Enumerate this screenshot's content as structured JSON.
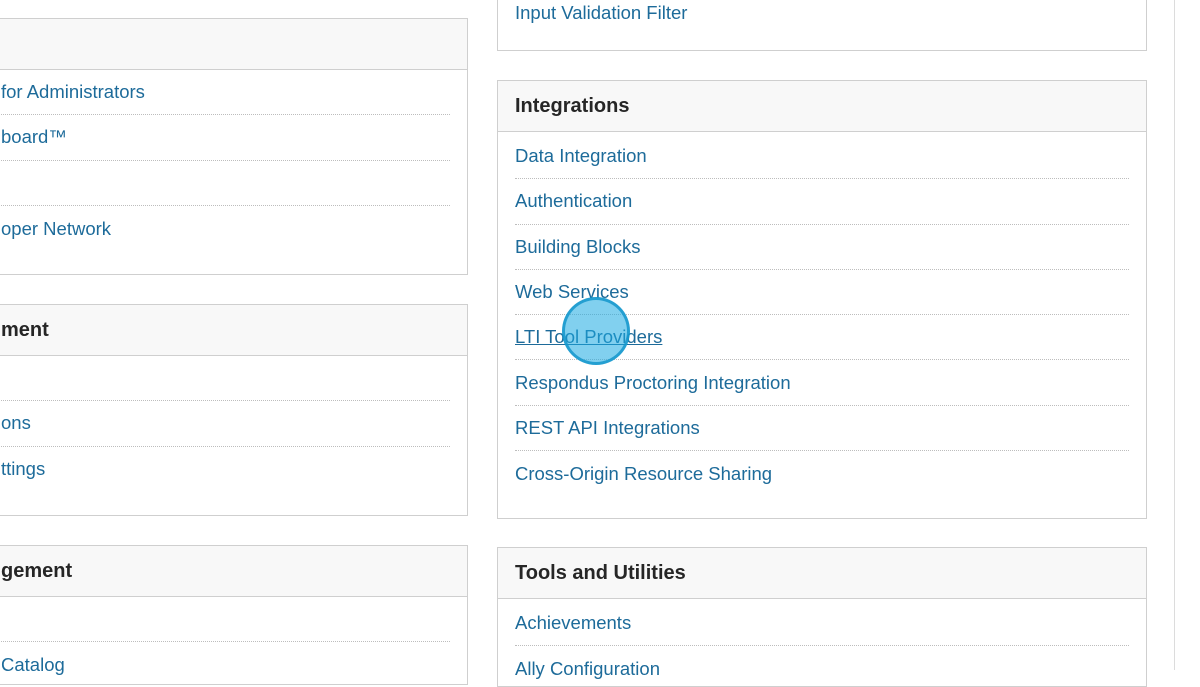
{
  "left_column": {
    "panel1": {
      "header": "",
      "items": [
        "for Administrators",
        "board™",
        "",
        "oper Network"
      ]
    },
    "panel2": {
      "header": "ment",
      "items": [
        "",
        "ons",
        "ttings"
      ]
    },
    "panel3": {
      "header": "gement",
      "items": [
        "",
        "Catalog"
      ]
    }
  },
  "right_column": {
    "top_panel": {
      "items": [
        "Input Validation Filter"
      ]
    },
    "integrations": {
      "header": "Integrations",
      "items": [
        "Data Integration",
        "Authentication",
        "Building Blocks",
        "Web Services",
        "LTI Tool Providers",
        "Respondus Proctoring Integration",
        "REST API Integrations",
        "Cross-Origin Resource Sharing"
      ]
    },
    "tools": {
      "header": "Tools and Utilities",
      "items": [
        "Achievements",
        "Ally Configuration"
      ]
    }
  }
}
